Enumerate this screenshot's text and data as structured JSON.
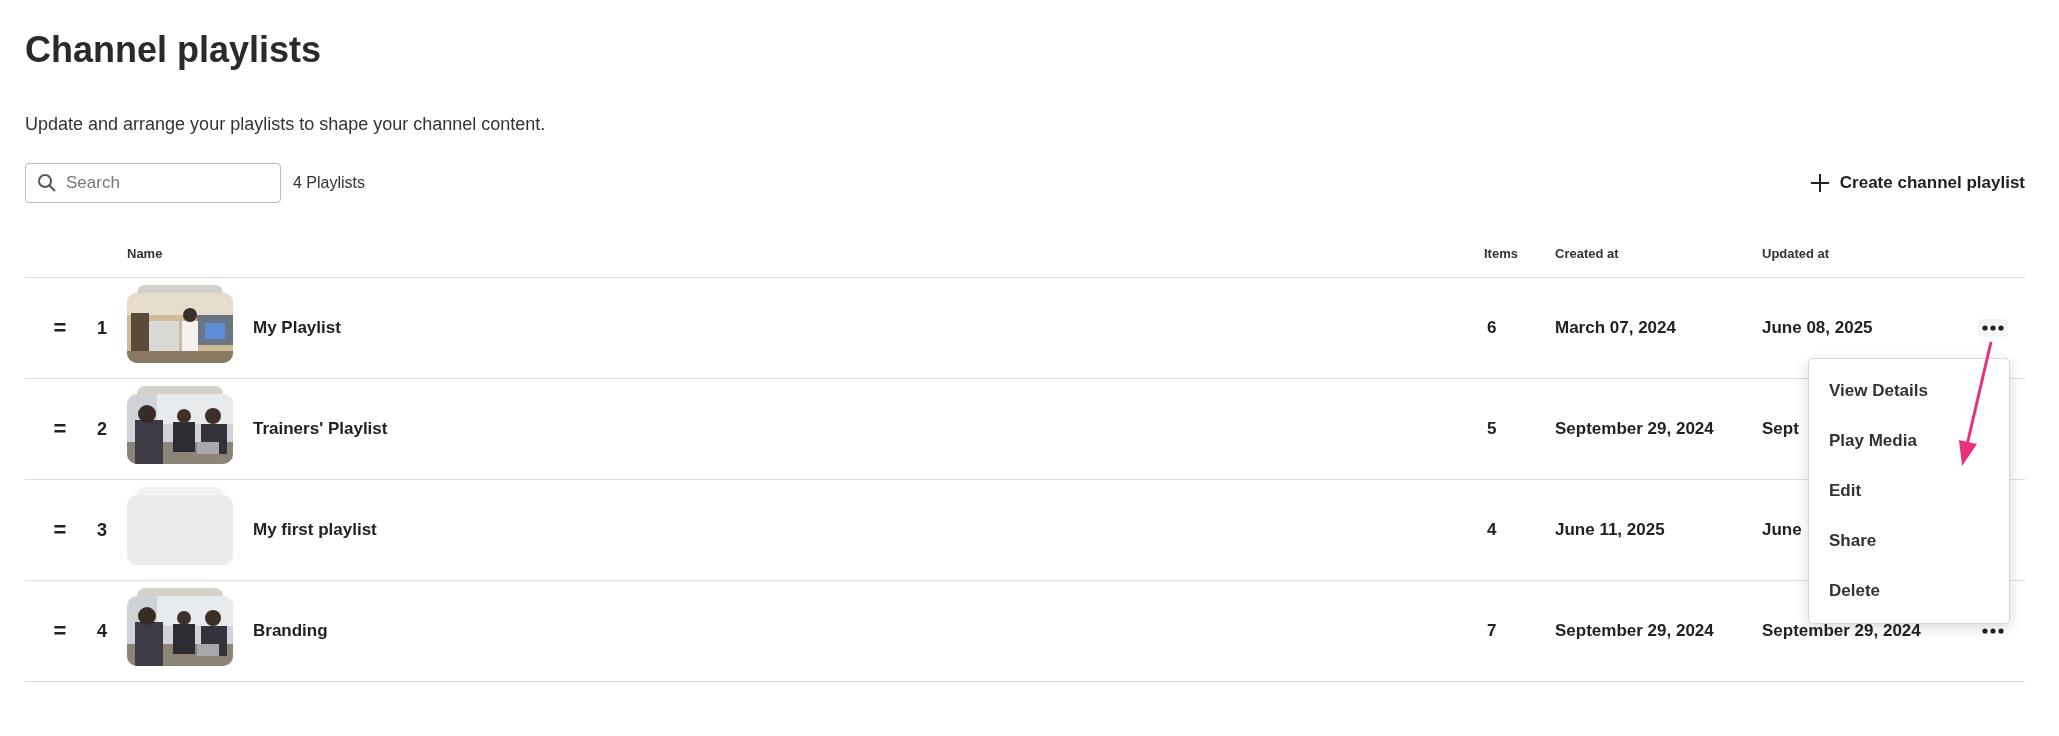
{
  "page": {
    "title": "Channel playlists",
    "subtitle": "Update and arrange your playlists to shape your channel content."
  },
  "toolbar": {
    "search": {
      "placeholder": "Search"
    },
    "count": "4 Playlists",
    "create_button": "Create channel playlist"
  },
  "table": {
    "columns": [
      "Name",
      "Items",
      "Created at",
      "Updated at"
    ],
    "rows": [
      {
        "handle": "=",
        "number": "1",
        "name": "My Playlist",
        "items": "6",
        "created": "March 07, 2024",
        "updated": "June 08, 2025",
        "more_button": true,
        "menu_open": true
      },
      {
        "handle": "=",
        "number": "2",
        "name": "Trainers' Playlist",
        "items": "5",
        "created": "September 29, 2024",
        "updated": "Sept",
        "more_button": false,
        "menu_open": false
      },
      {
        "handle": "=",
        "number": "3",
        "thumbnail": {
          "kind": "empty"
        },
        "name": "My first playlist",
        "items": "4",
        "created": "June 11, 2025",
        "updated": "June",
        "more_button": false,
        "menu_open": false
      },
      {
        "handle": "=",
        "number": "4",
        "name": "Branding",
        "items": "7",
        "created": "September 29, 2024",
        "updated": "September 29, 2024",
        "more_button": true,
        "menu_open": false
      }
    ]
  },
  "context_menu": {
    "items": [
      "View Details",
      "Play Media",
      "Edit",
      "Share",
      "Delete"
    ]
  }
}
